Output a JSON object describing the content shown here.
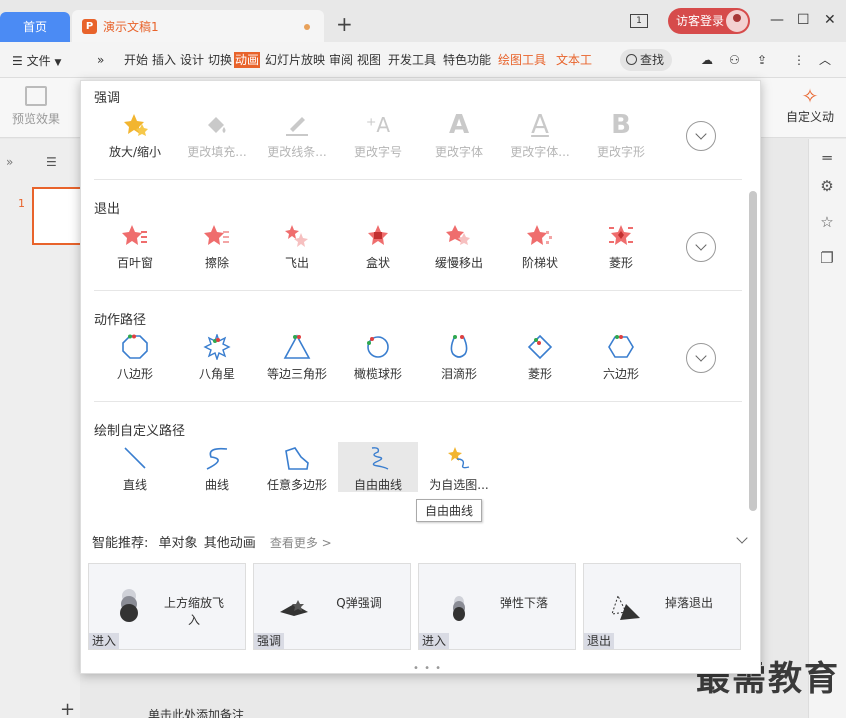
{
  "titlebar": {
    "home_tab": "首页",
    "doc_tab": "演示文稿1",
    "doc_icon": "P",
    "window_count": "1",
    "visitor_login": "访客登录"
  },
  "ribbon_tabs": {
    "file": "文件",
    "tabs": [
      "开始",
      "插入",
      "设计",
      "切换",
      "动画",
      "幻灯片放映",
      "审阅",
      "视图",
      "开发工具",
      "特色功能",
      "绘图工具",
      "文本工"
    ],
    "search": "查找"
  },
  "ribbon": {
    "preview": "预览效果",
    "custom_animation": "自定义动"
  },
  "left": {
    "slide_number": "1"
  },
  "panel": {
    "sections": [
      {
        "title": "强调",
        "items": [
          "放大/缩小",
          "更改填充...",
          "更改线条...",
          "更改字号",
          "更改字体",
          "更改字体...",
          "更改字形"
        ]
      },
      {
        "title": "退出",
        "items": [
          "百叶窗",
          "擦除",
          "飞出",
          "盒状",
          "缓慢移出",
          "阶梯状",
          "菱形"
        ]
      },
      {
        "title": "动作路径",
        "items": [
          "八边形",
          "八角星",
          "等边三角形",
          "橄榄球形",
          "泪滴形",
          "菱形",
          "六边形"
        ]
      },
      {
        "title": "绘制自定义路径",
        "items": [
          "直线",
          "曲线",
          "任意多边形",
          "自由曲线",
          "为自选图..."
        ]
      }
    ],
    "tooltip": "自由曲线",
    "smart": {
      "label": "智能推荐:",
      "single": "单对象",
      "other": "其他动画",
      "more": "查看更多 >"
    },
    "cards": [
      {
        "name": "上方缩放飞入",
        "tag": "进入"
      },
      {
        "name": "Q弹强调",
        "tag": "强调"
      },
      {
        "name": "弹性下落",
        "tag": "进入"
      },
      {
        "name": "掉落退出",
        "tag": "退出"
      }
    ]
  },
  "bottom_note": "单击此处添加备注",
  "watermark": "最需教育",
  "colors": {
    "accent": "#e8632b",
    "home_tab": "#4b8bf4",
    "visitor": "#d64b4b"
  }
}
